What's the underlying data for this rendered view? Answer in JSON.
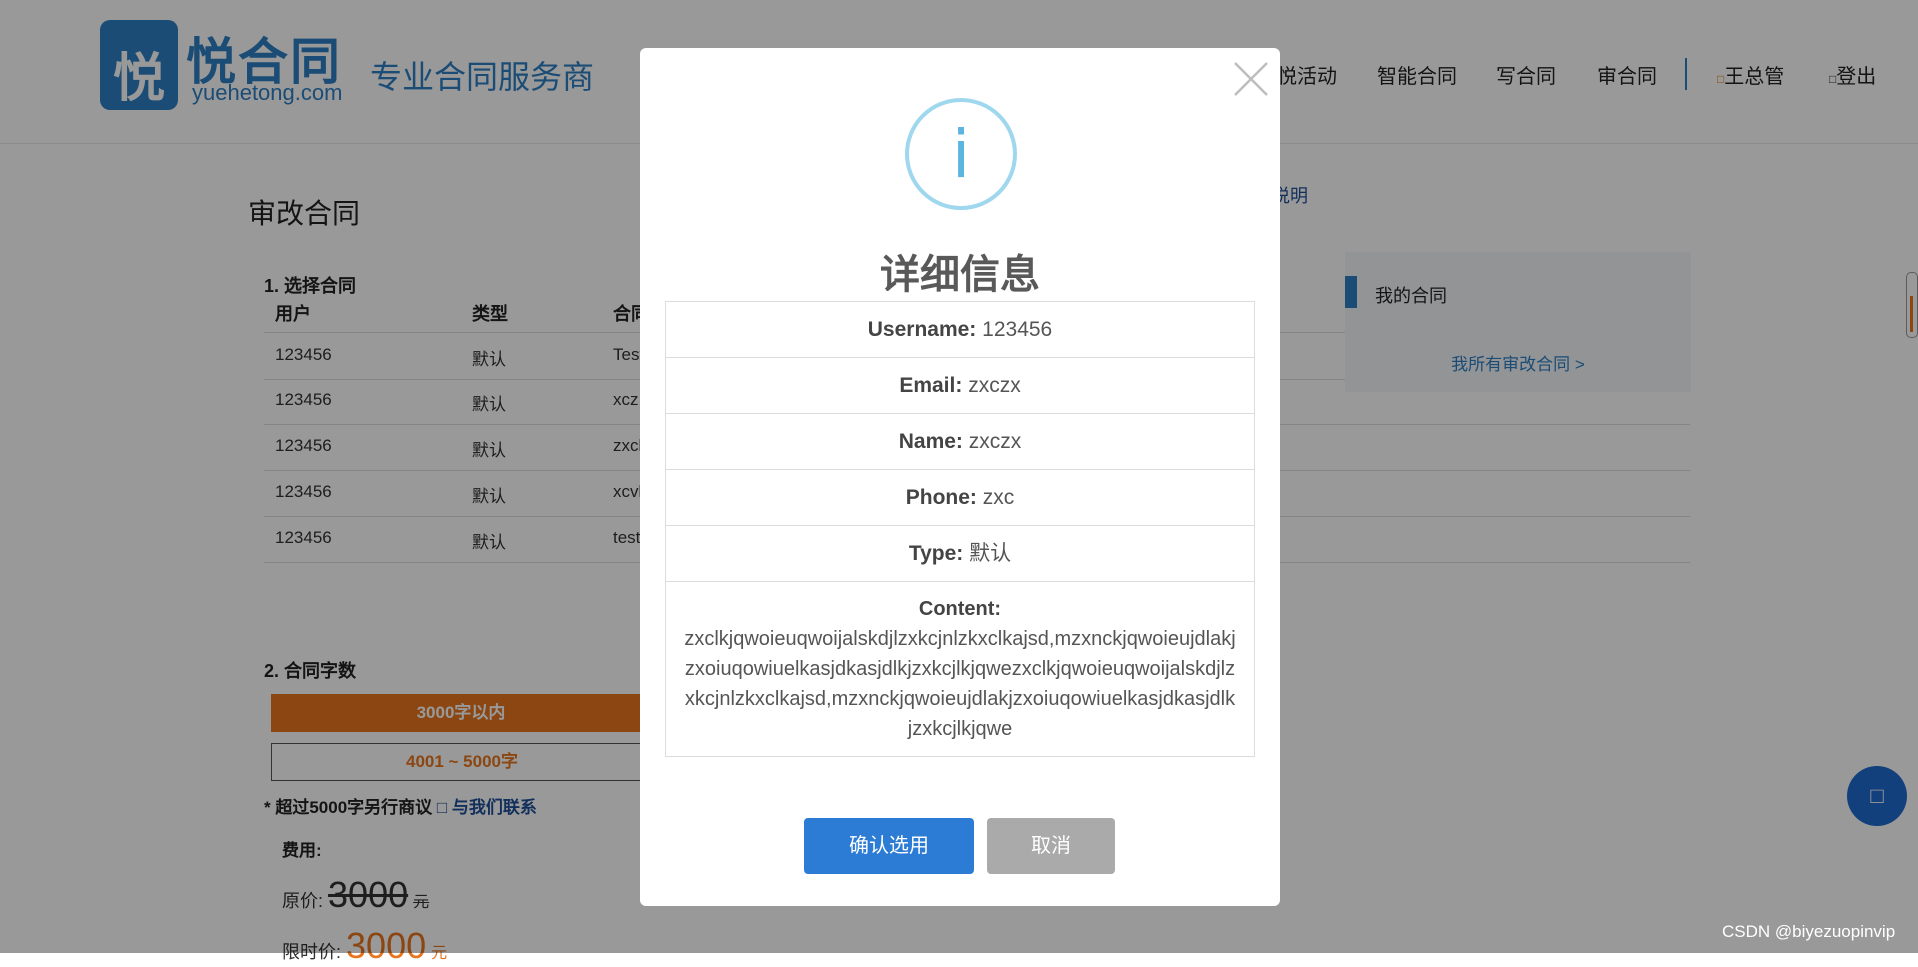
{
  "header": {
    "logo_glyph": "悦",
    "logo_cn": "悦合同",
    "logo_en": "yuehetong.com",
    "slogan": "专业合同服务商",
    "nav": [
      {
        "label": "悦活动"
      },
      {
        "label": "智能合同"
      },
      {
        "label": "写合同"
      },
      {
        "label": "审合同"
      }
    ],
    "user": {
      "label": "王总管"
    },
    "logout": {
      "label": "登出"
    }
  },
  "page": {
    "title": "审改合同",
    "section1": "1. 选择合同",
    "table_headers": [
      "用户",
      "类型",
      "合同"
    ],
    "rows": [
      {
        "user": "123456",
        "type": "默认",
        "name": "Test"
      },
      {
        "user": "123456",
        "type": "默认",
        "name": "xcz"
      },
      {
        "user": "123456",
        "type": "默认",
        "name": "zxcl"
      },
      {
        "user": "123456",
        "type": "默认",
        "name": "xcvl"
      },
      {
        "user": "123456",
        "type": "默认",
        "name": "test"
      }
    ],
    "section2": "2. 合同字数",
    "word_option_active": "3000字以内",
    "word_option_outline": "4001 ~ 5000字",
    "note": "* 超过5000字另行商议",
    "note_link": "与我们联系",
    "fee_label": "费用:",
    "orig_price_label": "原价:",
    "orig_price": "3000",
    "orig_unit": "元",
    "limit_price_label": "限时价:",
    "limit_price": "3000",
    "limit_unit": "元",
    "side_link": "说明",
    "side_panel_title": "我的合同",
    "side_panel_link": "我所有审改合同 >"
  },
  "modal": {
    "title": "详细信息",
    "fields": {
      "username": {
        "label": "Username:",
        "value": "123456"
      },
      "email": {
        "label": "Email:",
        "value": "zxczx"
      },
      "name": {
        "label": "Name:",
        "value": "zxczx"
      },
      "phone": {
        "label": "Phone:",
        "value": "zxc"
      },
      "type": {
        "label": "Type:",
        "value": "默认"
      },
      "content": {
        "label": "Content:",
        "value": "zxclkjqwoieuqwoijalskdjlzxkcjnlzkxclkajsd,mzxnckjqwoieujdlakjzxoiuqowiuelkasjdkasjdlkjzxkcjlkjqwezxclkjqwoieuqwoijalskdjlzxkcjnlzkxclkajsd,mzxnckjqwoieujdlakjzxoiuqowiuelkasjdkasjdlkjzxkcjlkjqwe"
      }
    },
    "confirm_label": "确认选用",
    "cancel_label": "取消"
  },
  "watermark": "CSDN @biyezuopinvip",
  "icons": {
    "close": "close-icon",
    "info": "info-icon",
    "user": "user-icon",
    "logout": "logout-icon",
    "contact": "chat-icon",
    "float": "chat-icon"
  }
}
